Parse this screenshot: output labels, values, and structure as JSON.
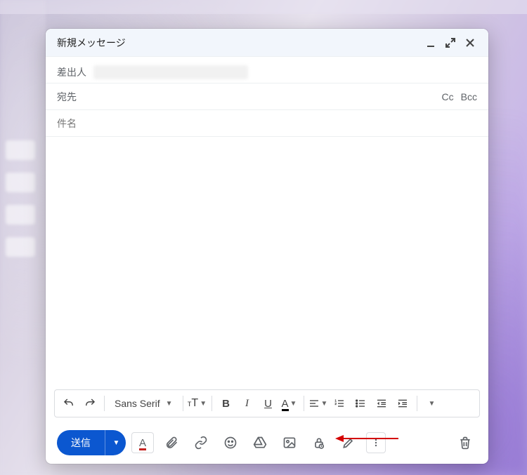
{
  "window": {
    "title": "新規メッセージ"
  },
  "fields": {
    "from_label": "差出人",
    "to_label": "宛先",
    "cc_label": "Cc",
    "bcc_label": "Bcc",
    "subject_placeholder": "件名"
  },
  "format_toolbar": {
    "font_family": "Sans Serif",
    "size_glyph": "тT",
    "bold": "B",
    "italic": "I",
    "underline": "U",
    "color_glyph": "A"
  },
  "bottom": {
    "send_label": "送信"
  }
}
